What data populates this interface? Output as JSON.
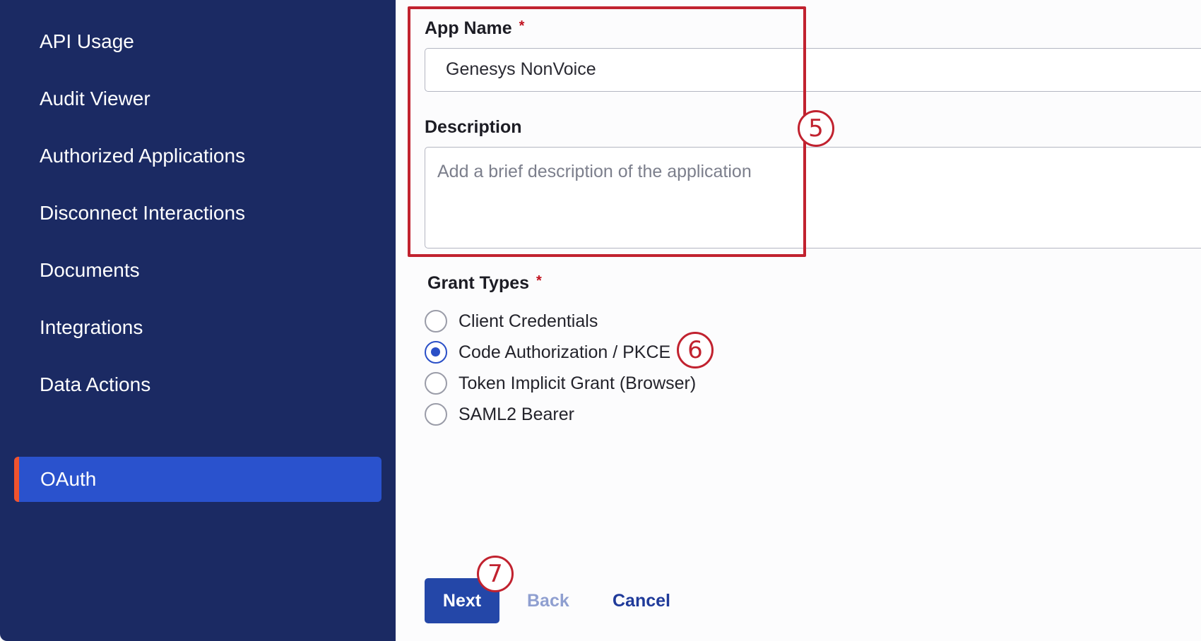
{
  "sidebar": {
    "items": [
      {
        "label": "API Usage"
      },
      {
        "label": "Audit Viewer"
      },
      {
        "label": "Authorized Applications"
      },
      {
        "label": "Disconnect Interactions"
      },
      {
        "label": "Documents"
      },
      {
        "label": "Integrations"
      },
      {
        "label": "Data Actions"
      },
      {
        "label": "OAuth",
        "active": true
      }
    ]
  },
  "form": {
    "app_name_label": "App Name",
    "required_mark": "*",
    "app_name_value": "Genesys NonVoice",
    "description_label": "Description",
    "description_placeholder": "Add a brief description of the application",
    "grant_types_label": "Grant Types",
    "grant_types": [
      {
        "label": "Client Credentials",
        "checked": false
      },
      {
        "label": "Code Authorization / PKCE",
        "checked": true
      },
      {
        "label": "Token Implicit Grant (Browser)",
        "checked": false
      },
      {
        "label": "SAML2 Bearer",
        "checked": false
      }
    ]
  },
  "actions": {
    "next_label": "Next",
    "back_label": "Back",
    "cancel_label": "Cancel",
    "back_color": "#8f9fd0",
    "cancel_color": "#1f3a9a"
  },
  "callouts": {
    "step5": "5",
    "step6": "6",
    "step7": "7"
  },
  "colors": {
    "sidebar_bg": "#1b2a63",
    "active_item_bg": "#2a52cd",
    "active_indicator": "#f0532e",
    "annotation_red": "#c1222f",
    "primary_button": "#2447a8"
  }
}
